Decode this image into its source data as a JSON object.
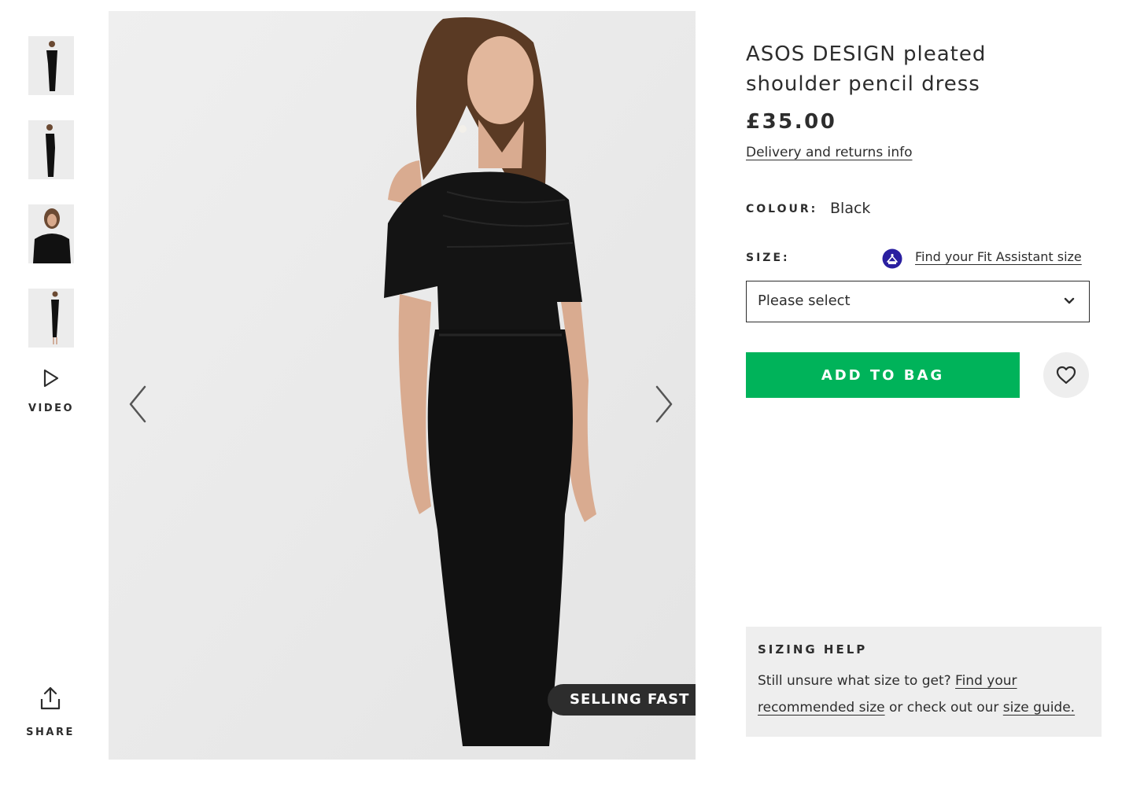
{
  "thumbnails": [
    {
      "alt": "product-view-front"
    },
    {
      "alt": "product-view-side"
    },
    {
      "alt": "product-view-closeup"
    },
    {
      "alt": "product-view-full"
    }
  ],
  "video_label": "VIDEO",
  "share_label": "SHARE",
  "main_image": {
    "badge": "SELLING FAST"
  },
  "product": {
    "title_line1": "ASOS DESIGN pleated",
    "title_line2": "shoulder pencil dress",
    "price": "£35.00",
    "delivery_link": "Delivery and returns info",
    "colour_label": "COLOUR:",
    "colour_value": "Black",
    "size_label": "SIZE:",
    "fit_assistant_link": "Find your Fit Assistant size",
    "size_select_placeholder": "Please select",
    "add_to_bag": "ADD TO BAG"
  },
  "sizing_help": {
    "heading": "SIZING HELP",
    "text_prefix": "Still unsure what size to get? ",
    "link1_line1": "Find your",
    "link1_line2": "recommended size",
    "text_middle": " or check out our ",
    "link2": "size guide."
  },
  "colors": {
    "accent_green": "#00b35a",
    "text": "#2d2d2d",
    "panel_bg": "#eeeeee",
    "fit_icon": "#2a1fa0"
  }
}
